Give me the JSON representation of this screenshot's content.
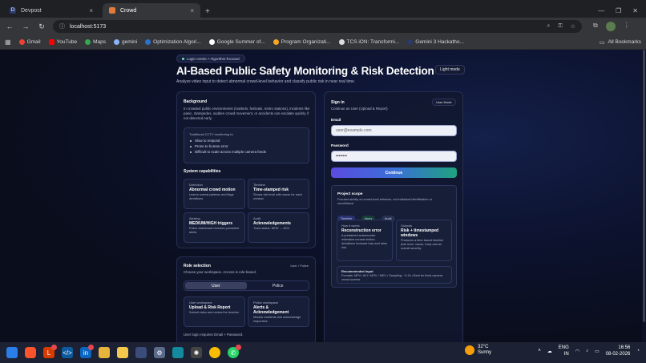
{
  "browser": {
    "tabs": [
      {
        "label": "Devpost",
        "active": false
      },
      {
        "label": "Crowd",
        "active": true
      }
    ],
    "url": "localhost:5173",
    "bookmarks": [
      "Gmail",
      "YouTube",
      "Maps",
      "gemini",
      "Optimization Algori...",
      "Google Summer of...",
      "Program Organizati...",
      "TCS iON: Transformi...",
      "Gemini 3 Hackatho..."
    ],
    "all_bookmarks": "All Bookmarks"
  },
  "header": {
    "pill": "Logic-centric • Algorithm-focused",
    "title": "AI-Based Public Safety Monitoring & Risk Detection",
    "subtitle": "Analyze video input to detect abnormal crowd-level behavior and classify public risk in near real time.",
    "light_mode": "Light mode"
  },
  "background": {
    "heading": "Background",
    "text": "In crowded public environments (markets, festivals, metro stations), incidents like panic, stampedes, sudden crowd movement, or accidents can escalate quickly if not detected early.",
    "cctv_title": "Traditional CCTV monitoring is:",
    "cctv_items": [
      "Slow to respond",
      "Prone to human error",
      "Difficult to scale across multiple camera feeds"
    ],
    "cap_heading": "System capabilities",
    "capabilities": [
      {
        "label": "Detection",
        "value": "Abnormal crowd motion",
        "desc": "Learns normal patterns and flags deviations."
      },
      {
        "label": "Timeline",
        "value": "Time-stamped risk",
        "desc": "Shows risk level with cause for each window."
      },
      {
        "label": "Alerting",
        "value": "MEDIUM/HIGH triggers",
        "desc": "Police dashboard receives persistent alerts."
      },
      {
        "label": "Audit",
        "value": "Acknowledgements",
        "desc": "Track status: NEW → ACK."
      }
    ]
  },
  "role": {
    "heading": "Role selection",
    "corner": "User / Police",
    "text": "Choose your workspace. Access is role-based.",
    "options": [
      "User",
      "Police"
    ],
    "workspaces": [
      {
        "label": "User workspace",
        "value": "Upload & Risk Report",
        "desc": "Submit video and review the timeline."
      },
      {
        "label": "Police workspace",
        "value": "Alerts & Acknowledgement",
        "desc": "Monitor incidents and acknowledge responses."
      }
    ],
    "note": "User login requires Email + Password."
  },
  "signin": {
    "heading": "Sign in",
    "text": "Continue as User (Upload & Report)",
    "user_mode": "User Mode",
    "email_label": "Email",
    "email_placeholder": "user@example.com",
    "password_label": "Password",
    "password_value": "••••••••",
    "continue": "Continue"
  },
  "scope": {
    "heading": "Project scope",
    "text": "Focuses strictly on crowd-level behavior, not individual identification or surveillance.",
    "tags": [
      "Timeline",
      "Alerts",
      "Audit"
    ],
    "how": {
      "label": "How it works",
      "value": "Reconstruction error",
      "desc": "A pretrained autoencoder estimates normal motion; deviations increase loss and raise risk."
    },
    "outputs": {
      "label": "Outputs",
      "value": "Risk + timestamped windows",
      "desc": "Produces a time-based timeline (risk level, cause, loss) and an overall severity."
    },
    "rec": {
      "label": "Recommended input",
      "desc": "Formats: MP4 / AVI / MOV / MKV • Sampling: ~0.2s • Best for fixed-camera crowd scenes."
    }
  },
  "taskbar": {
    "weather_temp": "32°C",
    "weather_desc": "Sunny",
    "lang1": "ENG",
    "lang2": "IN",
    "time": "16:56",
    "date": "08-02-2026"
  }
}
